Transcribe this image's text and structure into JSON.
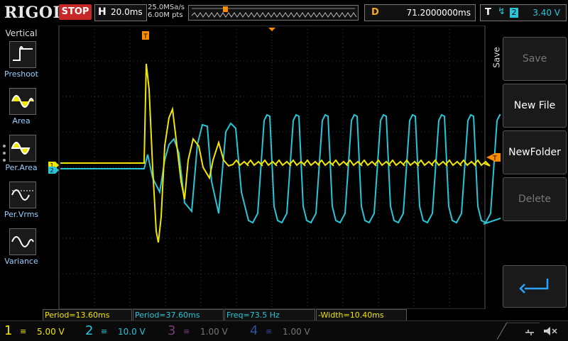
{
  "top": {
    "logo": "RIGOL",
    "run_state": "STOP",
    "horizontal": {
      "key": "H",
      "value": "20.0ms"
    },
    "sample_rate": "25.0MSa/s",
    "mem_depth": "6.00M pts",
    "delay": {
      "key": "D",
      "value": "71.2000000ms"
    },
    "trigger": {
      "key": "T",
      "edge": "↯",
      "source": "2",
      "level": "3.40 V"
    }
  },
  "left_panel": {
    "title": "Vertical",
    "items": [
      {
        "label": "Preshoot",
        "icon": "preshoot-icon"
      },
      {
        "label": "Area",
        "icon": "area-icon"
      },
      {
        "label": "Per.Area",
        "icon": "per-area-icon"
      },
      {
        "label": "Per.Vrms",
        "icon": "per-vrms-icon"
      },
      {
        "label": "Variance",
        "icon": "variance-icon"
      }
    ]
  },
  "right_panel": {
    "title": "Save",
    "buttons": [
      {
        "label": "Save",
        "enabled": false
      },
      {
        "label": "New File",
        "enabled": true
      },
      {
        "label": "NewFolder",
        "enabled": true
      },
      {
        "label": "Delete",
        "enabled": false
      }
    ],
    "return_icon": "return-arrow-icon"
  },
  "measurements": [
    {
      "text": "Period=13.60ms",
      "color": "#f2e600"
    },
    {
      "text": "Period=37.60ms",
      "color": "#29c5d8"
    },
    {
      "text": "Freq=73.5 Hz",
      "color": "#29c5d8"
    },
    {
      "text": "-Width=10.40ms",
      "color": "#f2e600"
    }
  ],
  "channels": [
    {
      "num": "1",
      "coupling": "≡",
      "scale": "5.00 V",
      "color": "#f2e600",
      "active": true
    },
    {
      "num": "2",
      "coupling": "≡",
      "scale": "10.0 V",
      "color": "#29c5d8",
      "active": true
    },
    {
      "num": "3",
      "coupling": "≡",
      "scale": "1.00 V",
      "color": "#c05ac0",
      "active": false
    },
    {
      "num": "4",
      "coupling": "≡",
      "scale": "1.00 V",
      "color": "#3a6fd8",
      "active": false
    }
  ],
  "markers": {
    "ch1": "1",
    "ch2": "2",
    "trigger_pos": "T",
    "trigger_level": "T"
  },
  "colors": {
    "ch1": "#f2e600",
    "ch2": "#29c5d8",
    "grid": "#3a3a3a",
    "trigger": "#ff8c00"
  }
}
